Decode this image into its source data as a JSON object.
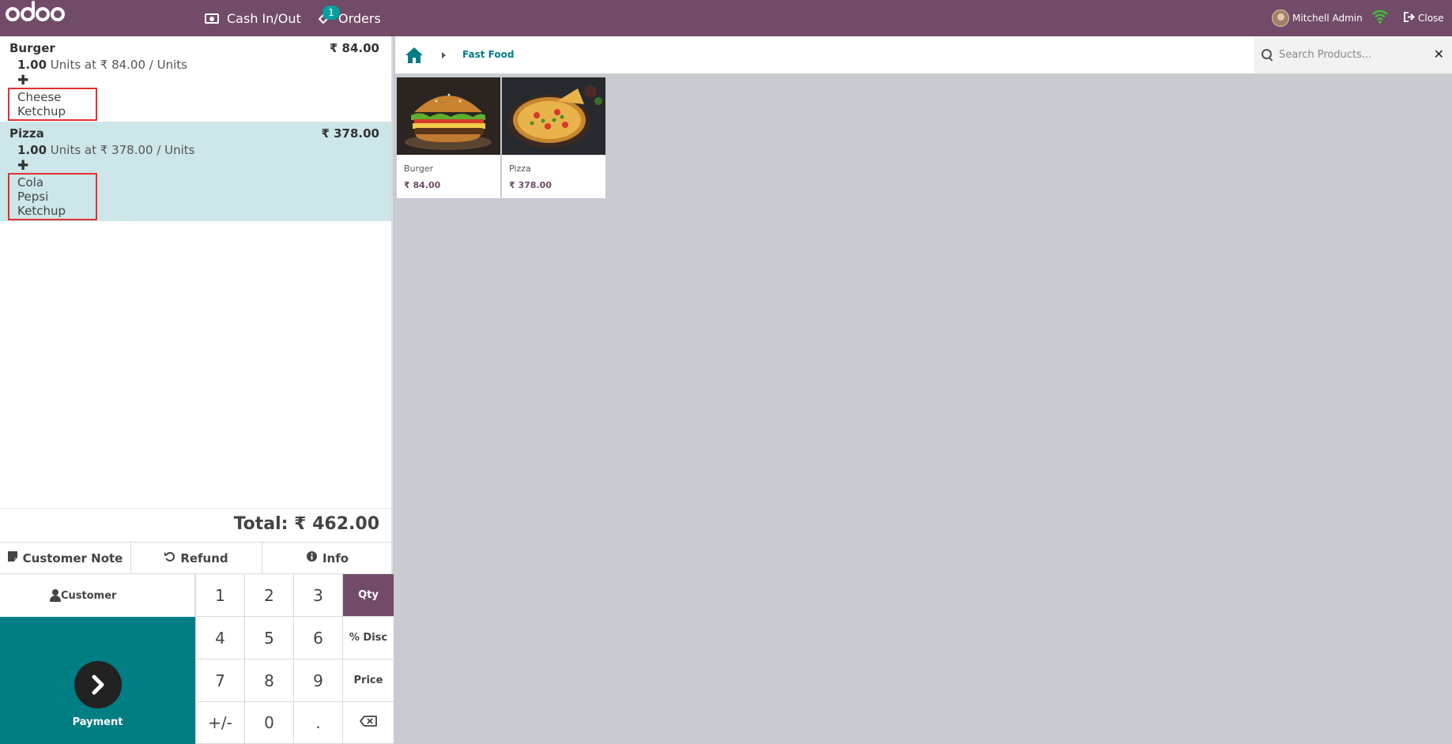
{
  "header": {
    "cash_label": "Cash In/Out",
    "orders_label": "Orders",
    "orders_badge": "1",
    "user_name": "Mitchell Admin",
    "close_label": "Close"
  },
  "order": {
    "lines": [
      {
        "name": "Burger",
        "price": "₹ 84.00",
        "qty": "1.00",
        "unit_info": "Units at ₹ 84.00 / Units",
        "toppings": [
          "Cheese",
          "Ketchup"
        ]
      },
      {
        "name": "Pizza",
        "price": "₹ 378.00",
        "qty": "1.00",
        "unit_info": "Units at ₹ 378.00 / Units",
        "toppings": [
          "Cola",
          "Pepsi",
          "Ketchup"
        ]
      }
    ],
    "total": "Total: ₹ 462.00"
  },
  "actions": {
    "customer_note": "Customer Note",
    "refund": "Refund",
    "info": "Info"
  },
  "customer_label": "Customer",
  "payment_label": "Payment",
  "numpad": {
    "keys": [
      "1",
      "2",
      "3",
      "Qty",
      "4",
      "5",
      "6",
      "% Disc",
      "7",
      "8",
      "9",
      "Price",
      "+/-",
      "0",
      "."
    ],
    "active_mode": "Qty"
  },
  "breadcrumb": {
    "category": "Fast Food"
  },
  "search": {
    "placeholder": "Search Products..."
  },
  "products": [
    {
      "name": "Burger",
      "price": "₹ 84.00"
    },
    {
      "name": "Pizza",
      "price": "₹ 378.00"
    }
  ],
  "colors": {
    "brand": "#714b67",
    "teal": "#017e84",
    "selected_line": "#cce6e9",
    "highlight_box": "#e23030"
  }
}
